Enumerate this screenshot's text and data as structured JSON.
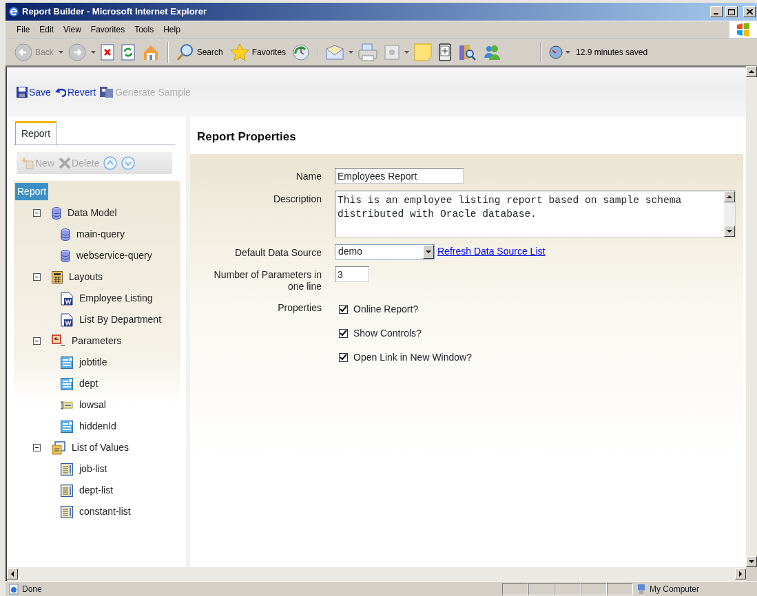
{
  "window": {
    "title": "Report Builder - Microsoft Internet Explorer"
  },
  "menu": [
    {
      "label": "File"
    },
    {
      "label": "Edit"
    },
    {
      "label": "View"
    },
    {
      "label": "Favorites"
    },
    {
      "label": "Tools"
    },
    {
      "label": "Help"
    }
  ],
  "browser_toolbar": {
    "back": {
      "label": "Back",
      "disabled": true
    },
    "search": "Search",
    "favorites": "Favorites",
    "timer": "12.9 minutes saved"
  },
  "app_toolbar": [
    {
      "kind": "save",
      "label": "Save",
      "disabled": false
    },
    {
      "kind": "revert",
      "label": "Revert",
      "disabled": false
    },
    {
      "kind": "generate",
      "label": "Generate Sample",
      "disabled": true
    }
  ],
  "panel_tabs": [
    {
      "label": "Report",
      "selected": true
    }
  ],
  "tree_toolbar": [
    {
      "kind": "new",
      "label": "New",
      "disabled": true
    },
    {
      "kind": "delete",
      "label": "Delete",
      "disabled": true
    },
    {
      "kind": "up",
      "disabled": false
    },
    {
      "kind": "down",
      "disabled": false
    }
  ],
  "tree": {
    "label": "Report",
    "selected": true,
    "children": [
      {
        "kind": "data-model",
        "label": "Data Model",
        "expanded": true,
        "selected": false,
        "children": [
          {
            "kind": "query",
            "label": "main-query",
            "selected": false
          },
          {
            "kind": "query",
            "label": "webservice-query",
            "selected": false
          }
        ]
      },
      {
        "kind": "layouts",
        "label": "Layouts",
        "expanded": true,
        "selected": false,
        "children": [
          {
            "kind": "layout",
            "label": "Employee Listing",
            "selected": false
          },
          {
            "kind": "layout",
            "label": "List By Department",
            "selected": false
          }
        ]
      },
      {
        "kind": "parameters",
        "label": "Parameters",
        "expanded": true,
        "selected": false,
        "children": [
          {
            "kind": "menu-parameter",
            "label": "jobtitle",
            "selected": false
          },
          {
            "kind": "menu-parameter",
            "label": "dept",
            "selected": false
          },
          {
            "kind": "text-parameter",
            "label": "lowsal",
            "selected": false
          },
          {
            "kind": "menu-parameter",
            "label": "hiddenId",
            "selected": false
          }
        ]
      },
      {
        "kind": "lov-group",
        "label": "List of Values",
        "expanded": true,
        "selected": false,
        "children": [
          {
            "kind": "lov",
            "label": "job-list",
            "selected": false
          },
          {
            "kind": "lov",
            "label": "dept-list",
            "selected": false
          },
          {
            "kind": "lov",
            "label": "constant-list",
            "selected": false
          }
        ]
      }
    ]
  },
  "form": {
    "title": "Report Properties",
    "fields": [
      {
        "kind": "text",
        "label": "Name",
        "value": "Employees Report"
      },
      {
        "kind": "textarea",
        "label": "Description",
        "value": "This is an employee listing report based on sample schema distributed with Oracle database."
      },
      {
        "kind": "select",
        "label": "Default Data Source",
        "value": "demo",
        "link": "Refresh Data Source List"
      },
      {
        "kind": "short-text",
        "label": "Number of Parameters in one line",
        "value": "3"
      },
      {
        "kind": "checkboxes",
        "label": "Properties",
        "options": [
          {
            "label": "Online Report?",
            "checked": true
          },
          {
            "label": "Show Controls?",
            "checked": true
          },
          {
            "label": "Open Link in New Window?",
            "checked": true
          }
        ]
      }
    ]
  },
  "status_bar": {
    "text": "Done",
    "zone": "My Computer"
  }
}
